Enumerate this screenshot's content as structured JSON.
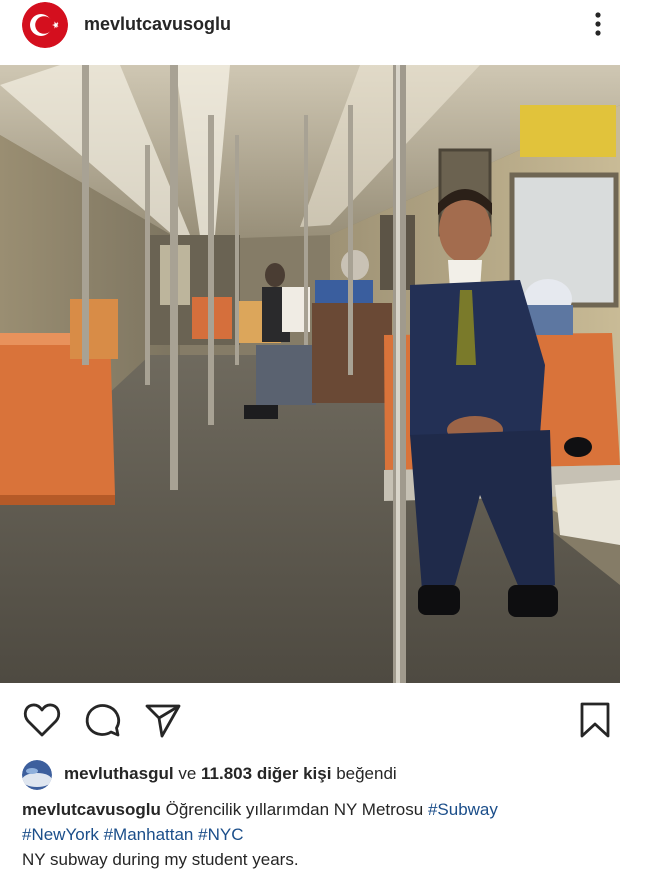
{
  "post": {
    "username": "mevlutcavusoglu"
  },
  "likes": {
    "liker": "mevluthasgul",
    "connector": "ve",
    "count_text": "11.803 diğer kişi",
    "suffix": "beğendi"
  },
  "caption": {
    "username": "mevlutcavusoglu",
    "text": "Öğrencilik yıllarımdan NY Metrosu",
    "hashtags": [
      "#Subway",
      "#NewYork",
      "#Manhattan",
      "#NYC"
    ],
    "translation": "NY subway during my student years."
  },
  "icons": {
    "avatar": "turkish-flag-avatar",
    "more": "vertical-ellipsis-icon",
    "like": "heart-icon",
    "comment": "comment-bubble-icon",
    "share": "paper-plane-icon",
    "save": "bookmark-icon"
  },
  "colors": {
    "text": "#262626",
    "hashtag": "#1b4e8a",
    "flag_red": "#e30a17",
    "seat_orange": "#d9733a"
  }
}
